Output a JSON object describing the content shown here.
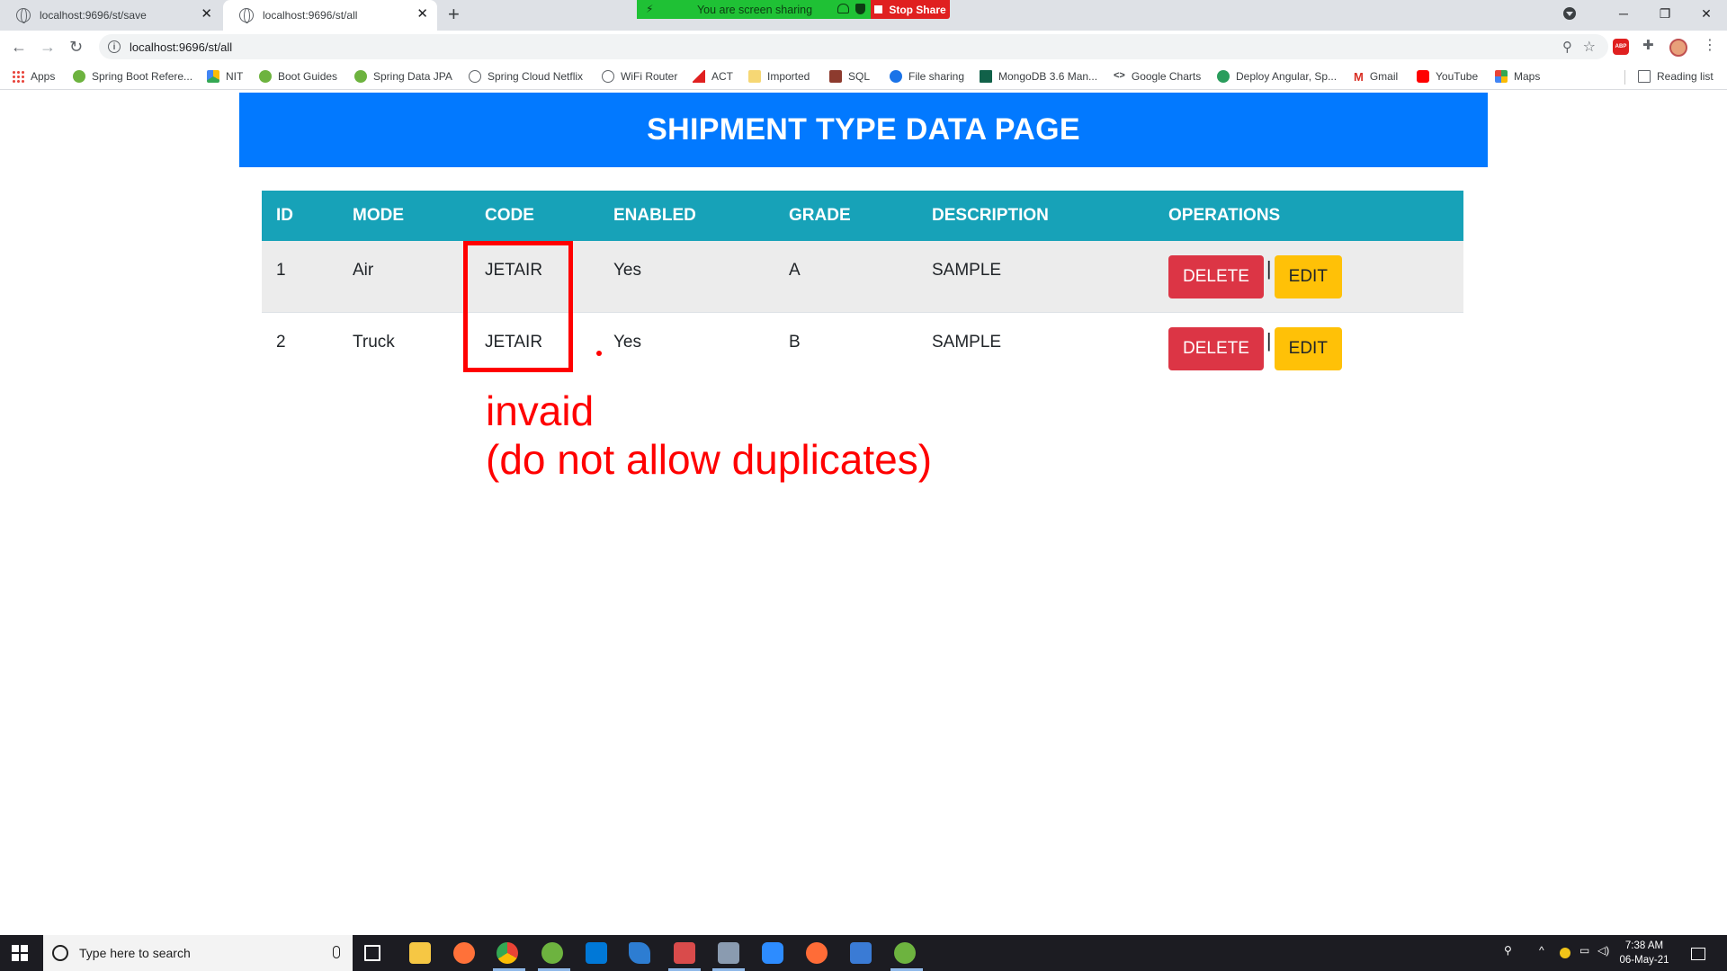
{
  "browser": {
    "tabs": [
      {
        "title": "localhost:9696/st/save",
        "active": false
      },
      {
        "title": "localhost:9696/st/all",
        "active": true
      }
    ],
    "url": "localhost:9696/st/all",
    "screen_share": {
      "message": "You are screen sharing",
      "stop_label": "Stop Share"
    },
    "bookmarks": [
      {
        "label": "Apps",
        "icon": "apps-grid-icon"
      },
      {
        "label": "Spring Boot Refere...",
        "icon": "spring-icon"
      },
      {
        "label": "NIT",
        "icon": "drive-icon"
      },
      {
        "label": "Boot Guides",
        "icon": "spring-icon"
      },
      {
        "label": "Spring Data JPA",
        "icon": "spring-icon"
      },
      {
        "label": "Spring Cloud Netflix",
        "icon": "globe-icon"
      },
      {
        "label": "WiFi Router",
        "icon": "globe-icon"
      },
      {
        "label": "ACT",
        "icon": "act-icon"
      },
      {
        "label": "Imported",
        "icon": "folder-icon"
      },
      {
        "label": "SQL",
        "icon": "sql-icon"
      },
      {
        "label": "File sharing",
        "icon": "share-icon"
      },
      {
        "label": "MongoDB 3.6 Man...",
        "icon": "mongodb-icon"
      },
      {
        "label": "Google Charts",
        "icon": "code-icon"
      },
      {
        "label": "Deploy Angular, Sp...",
        "icon": "deploy-icon"
      },
      {
        "label": "Gmail",
        "icon": "gmail-icon"
      },
      {
        "label": "YouTube",
        "icon": "youtube-icon"
      },
      {
        "label": "Maps",
        "icon": "maps-icon"
      }
    ],
    "reading_list": "Reading list"
  },
  "page": {
    "title": "SHIPMENT TYPE DATA PAGE",
    "table": {
      "headers": [
        "ID",
        "MODE",
        "CODE",
        "ENABLED",
        "GRADE",
        "DESCRIPTION",
        "OPERATIONS"
      ],
      "rows": [
        {
          "id": "1",
          "mode": "Air",
          "code": "JETAIR",
          "enabled": "Yes",
          "grade": "A",
          "description": "SAMPLE"
        },
        {
          "id": "2",
          "mode": "Truck",
          "code": "JETAIR",
          "enabled": "Yes",
          "grade": "B",
          "description": "SAMPLE"
        }
      ],
      "delete_label": "DELETE",
      "separator": "|",
      "edit_label": "EDIT"
    },
    "annotation": {
      "text": "invaid\n(do not allow duplicates)",
      "color": "#ff0000"
    }
  },
  "taskbar": {
    "search_placeholder": "Type here to search",
    "time": "7:38 AM",
    "date": "06-May-21"
  },
  "colors": {
    "banner": "#0279ff",
    "table_header": "#17a2b8",
    "delete_button": "#dc3545",
    "edit_button": "#ffc107"
  }
}
